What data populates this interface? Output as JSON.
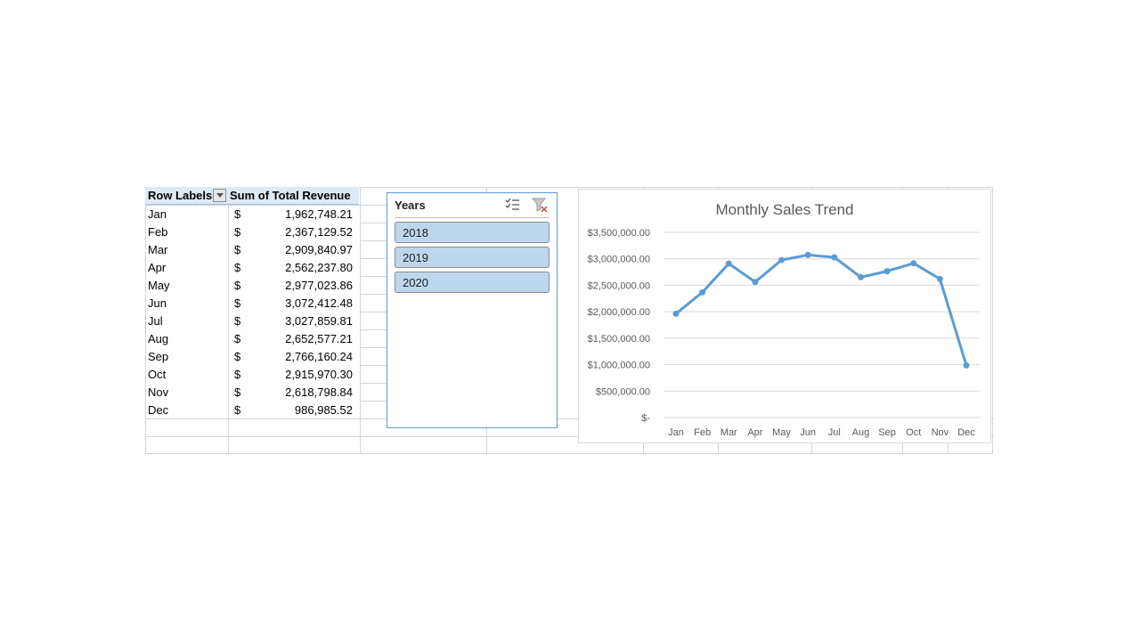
{
  "pivot": {
    "header": {
      "row_labels": "Row Labels",
      "sum_label": "Sum of Total Revenue"
    },
    "currency": "$",
    "rows": [
      {
        "label": "Jan",
        "value": "1,962,748.21"
      },
      {
        "label": "Feb",
        "value": "2,367,129.52"
      },
      {
        "label": "Mar",
        "value": "2,909,840.97"
      },
      {
        "label": "Apr",
        "value": "2,562,237.80"
      },
      {
        "label": "May",
        "value": "2,977,023.86"
      },
      {
        "label": "Jun",
        "value": "3,072,412.48"
      },
      {
        "label": "Jul",
        "value": "3,027,859.81"
      },
      {
        "label": "Aug",
        "value": "2,652,577.21"
      },
      {
        "label": "Sep",
        "value": "2,766,160.24"
      },
      {
        "label": "Oct",
        "value": "2,915,970.30"
      },
      {
        "label": "Nov",
        "value": "2,618,798.84"
      },
      {
        "label": "Dec",
        "value": "986,985.52"
      }
    ]
  },
  "slicer": {
    "title": "Years",
    "icons": [
      "multi-select-icon",
      "clear-filter-icon"
    ],
    "items": [
      "2018",
      "2019",
      "2020"
    ]
  },
  "colors": {
    "header_fill": "#ddebf7",
    "slicer_selected": "#bdd7ee",
    "slicer_border": "#5b9bd5",
    "series_line": "#5b9bd5",
    "gridline": "#d9d9d9"
  },
  "chart_data": {
    "type": "line",
    "title": "Monthly Sales Trend",
    "categories": [
      "Jan",
      "Feb",
      "Mar",
      "Apr",
      "May",
      "Jun",
      "Jul",
      "Aug",
      "Sep",
      "Oct",
      "Nov",
      "Dec"
    ],
    "values": [
      1962748.21,
      2367129.52,
      2909840.97,
      2562237.8,
      2977023.86,
      3072412.48,
      3027859.81,
      2652577.21,
      2766160.24,
      2915970.3,
      2618798.84,
      986985.52
    ],
    "yticks": [
      "$-",
      "$500,000.00",
      "$1,000,000.00",
      "$1,500,000.00",
      "$2,000,000.00",
      "$2,500,000.00",
      "$3,000,000.00",
      "$3,500,000.00"
    ],
    "ylim": [
      0,
      3500000
    ],
    "grid": true,
    "markers": true,
    "legend": "none"
  }
}
